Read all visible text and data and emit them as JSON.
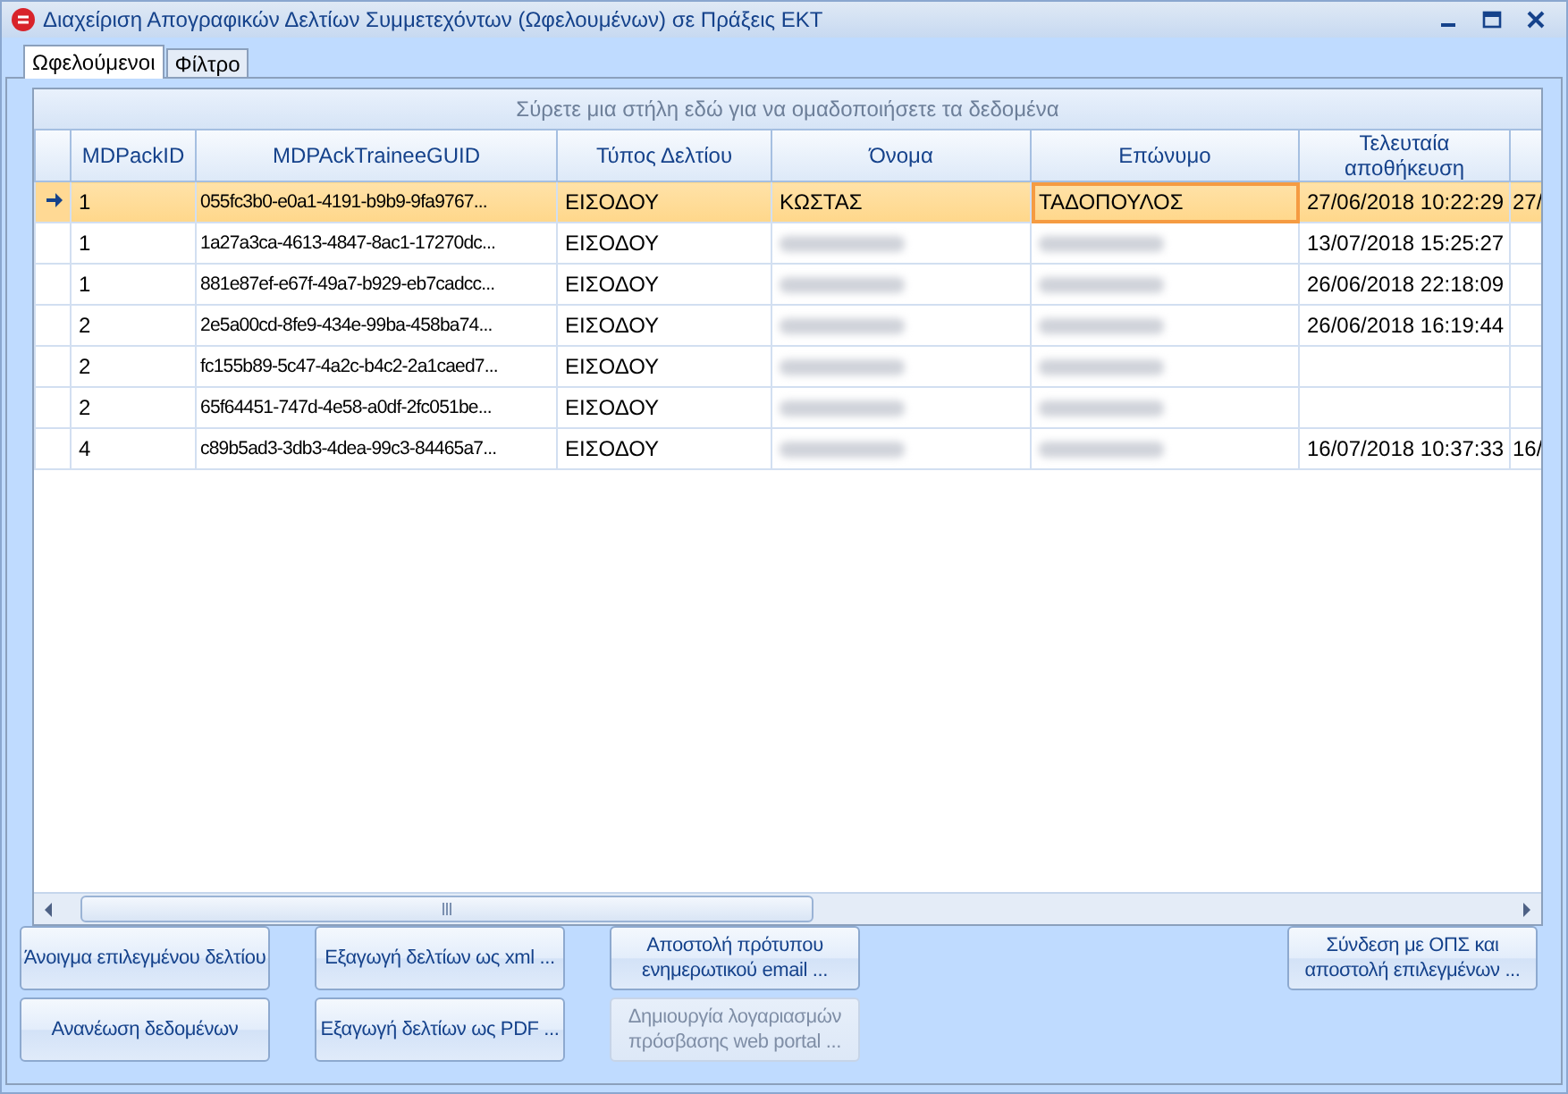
{
  "window": {
    "title": "Διαχείριση Απογραφικών Δελτίων Συμμετεχόντων (Ωφελουμένων) σε Πράξεις ΕΚΤ"
  },
  "tabs": [
    {
      "label": "Ωφελούμενοι",
      "selected": true
    },
    {
      "label": "Φίλτρο",
      "selected": false
    }
  ],
  "grid": {
    "group_panel": "Σύρετε μια στήλη εδώ για να ομαδοποιήσετε τα δεδομένα",
    "columns": [
      "MDPackID",
      "MDPAckTraineeGUID",
      "Τύπος Δελτίου",
      "Όνομα",
      "Επώνυμο",
      "Τελευταία αποθήκευση",
      ""
    ],
    "rows": [
      {
        "selected": true,
        "cells": [
          {
            "kind": "text",
            "text": "1",
            "focused": false
          },
          {
            "kind": "text",
            "text": "055fc3b0-e0a1-4191-b9b9-9fa9767...",
            "focused": false
          },
          {
            "kind": "text",
            "text": "ΕΙΣΟΔΟΥ",
            "focused": false
          },
          {
            "kind": "text",
            "text": "ΚΩΣΤΑΣ",
            "focused": false
          },
          {
            "kind": "text",
            "text": "ΤΑΔΟΠΟΥΛΟΣ",
            "focused": true
          },
          {
            "kind": "text",
            "text": "27/06/2018 10:22:29",
            "focused": false
          },
          {
            "kind": "text",
            "text": "27/",
            "focused": false
          }
        ]
      },
      {
        "selected": false,
        "cells": [
          {
            "kind": "text",
            "text": "1",
            "focused": false
          },
          {
            "kind": "text",
            "text": "1a27a3ca-4613-4847-8ac1-17270dc...",
            "focused": false
          },
          {
            "kind": "text",
            "text": "ΕΙΣΟΔΟΥ",
            "focused": false
          },
          {
            "kind": "blurred",
            "focused": false
          },
          {
            "kind": "blurred",
            "focused": false
          },
          {
            "kind": "text",
            "text": "13/07/2018 15:25:27",
            "focused": false
          },
          {
            "kind": "empty",
            "focused": false
          }
        ]
      },
      {
        "selected": false,
        "cells": [
          {
            "kind": "text",
            "text": "1",
            "focused": false
          },
          {
            "kind": "text",
            "text": "881e87ef-e67f-49a7-b929-eb7cadcc...",
            "focused": false
          },
          {
            "kind": "text",
            "text": "ΕΙΣΟΔΟΥ",
            "focused": false
          },
          {
            "kind": "blurred",
            "focused": false
          },
          {
            "kind": "blurred",
            "focused": false
          },
          {
            "kind": "text",
            "text": "26/06/2018 22:18:09",
            "focused": false
          },
          {
            "kind": "empty",
            "focused": false
          }
        ]
      },
      {
        "selected": false,
        "cells": [
          {
            "kind": "text",
            "text": "2",
            "focused": false
          },
          {
            "kind": "text",
            "text": "2e5a00cd-8fe9-434e-99ba-458ba74...",
            "focused": false
          },
          {
            "kind": "text",
            "text": "ΕΙΣΟΔΟΥ",
            "focused": false
          },
          {
            "kind": "blurred",
            "focused": false
          },
          {
            "kind": "blurred",
            "focused": false
          },
          {
            "kind": "text",
            "text": "26/06/2018 16:19:44",
            "focused": false
          },
          {
            "kind": "empty",
            "focused": false
          }
        ]
      },
      {
        "selected": false,
        "cells": [
          {
            "kind": "text",
            "text": "2",
            "focused": false
          },
          {
            "kind": "text",
            "text": "fc155b89-5c47-4a2c-b4c2-2a1caed7...",
            "focused": false
          },
          {
            "kind": "text",
            "text": "ΕΙΣΟΔΟΥ",
            "focused": false
          },
          {
            "kind": "blurred",
            "focused": false
          },
          {
            "kind": "blurred",
            "focused": false
          },
          {
            "kind": "empty",
            "focused": false
          },
          {
            "kind": "empty",
            "focused": false
          }
        ]
      },
      {
        "selected": false,
        "cells": [
          {
            "kind": "text",
            "text": "2",
            "focused": false
          },
          {
            "kind": "text",
            "text": "65f64451-747d-4e58-a0df-2fc051be...",
            "focused": false
          },
          {
            "kind": "text",
            "text": "ΕΙΣΟΔΟΥ",
            "focused": false
          },
          {
            "kind": "blurred",
            "focused": false
          },
          {
            "kind": "blurred",
            "focused": false
          },
          {
            "kind": "empty",
            "focused": false
          },
          {
            "kind": "empty",
            "focused": false
          }
        ]
      },
      {
        "selected": false,
        "cells": [
          {
            "kind": "text",
            "text": "4",
            "focused": false
          },
          {
            "kind": "text",
            "text": "c89b5ad3-3db3-4dea-99c3-84465a7...",
            "focused": false
          },
          {
            "kind": "text",
            "text": "ΕΙΣΟΔΟΥ",
            "focused": false
          },
          {
            "kind": "blurred",
            "focused": false
          },
          {
            "kind": "blurred",
            "focused": false
          },
          {
            "kind": "text",
            "text": "16/07/2018 10:37:33",
            "focused": false
          },
          {
            "kind": "text",
            "text": "16/",
            "focused": false
          }
        ]
      }
    ]
  },
  "button_columns": [
    [
      {
        "label": "Άνοιγμα επιλεγμένου δελτίου",
        "disabled": false
      },
      {
        "label": "Ανανέωση δεδομένων",
        "disabled": false
      }
    ],
    [
      {
        "label": "Εξαγωγή δελτίων ως xml ...",
        "disabled": false
      },
      {
        "label": "Εξαγωγή δελτίων ως PDF ...",
        "disabled": false
      }
    ],
    [
      {
        "label": "Αποστολή πρότυπου ενημερωτικού email ...",
        "disabled": false
      },
      {
        "label": "Δημιουργία λογαριασμών πρόσβασης web portal ...",
        "disabled": true
      }
    ],
    [
      {
        "label": "Σύνδεση με ΟΠΣ και αποστολή επιλεγμένων ...",
        "disabled": false
      }
    ]
  ]
}
